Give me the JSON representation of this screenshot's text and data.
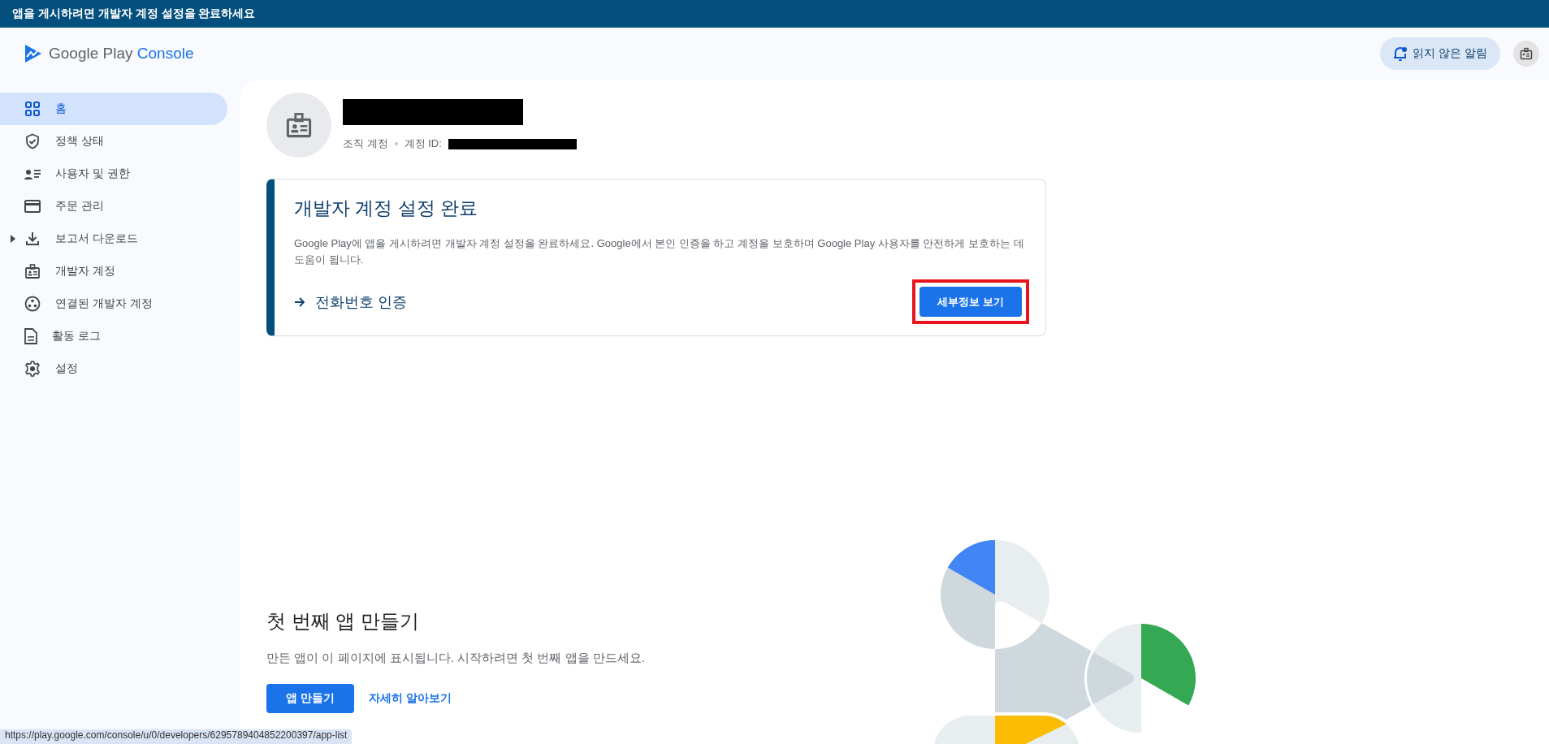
{
  "banner": {
    "text": "앱을 게시하려면 개발자 계정 설정을 완료하세요"
  },
  "header": {
    "logo": {
      "brand": "Google Play",
      "product": "Console"
    },
    "notifications_button": "읽지 않은 알림"
  },
  "sidebar": {
    "items": [
      {
        "label": "홈",
        "selected": true,
        "expandable": false
      },
      {
        "label": "정책 상태",
        "selected": false,
        "expandable": false
      },
      {
        "label": "사용자 및 권한",
        "selected": false,
        "expandable": false
      },
      {
        "label": "주문 관리",
        "selected": false,
        "expandable": false
      },
      {
        "label": "보고서 다운로드",
        "selected": false,
        "expandable": true
      },
      {
        "label": "개발자 계정",
        "selected": false,
        "expandable": false
      },
      {
        "label": "연결된 개발자 계정",
        "selected": false,
        "expandable": false
      },
      {
        "label": "활동 로그",
        "selected": false,
        "expandable": false
      },
      {
        "label": "설정",
        "selected": false,
        "expandable": false
      }
    ]
  },
  "account": {
    "type": "조직 계정",
    "id_label": "계정 ID:"
  },
  "setup_card": {
    "title": "개발자 계정 설정 완료",
    "description": "Google Play에 앱을 게시하려면 개발자 계정 설정을 완료하세요. Google에서 본인 인증을 하고 계정을 보호하며 Google Play 사용자를 안전하게 보호하는 데 도움이 됩니다.",
    "task_link": "전화번호 인증",
    "button": "세부정보 보기",
    "button_highlighted": true
  },
  "empty_state": {
    "title": "첫 번째 앱 만들기",
    "description": "만든 앱이 이 페이지에 표시됩니다. 시작하려면 첫 번째 앱을 만드세요.",
    "primary_button": "앱 만들기",
    "link": "자세히 알아보기"
  },
  "status_url": "https://play.google.com/console/u/0/developers/6295789404852200397/app-list"
}
